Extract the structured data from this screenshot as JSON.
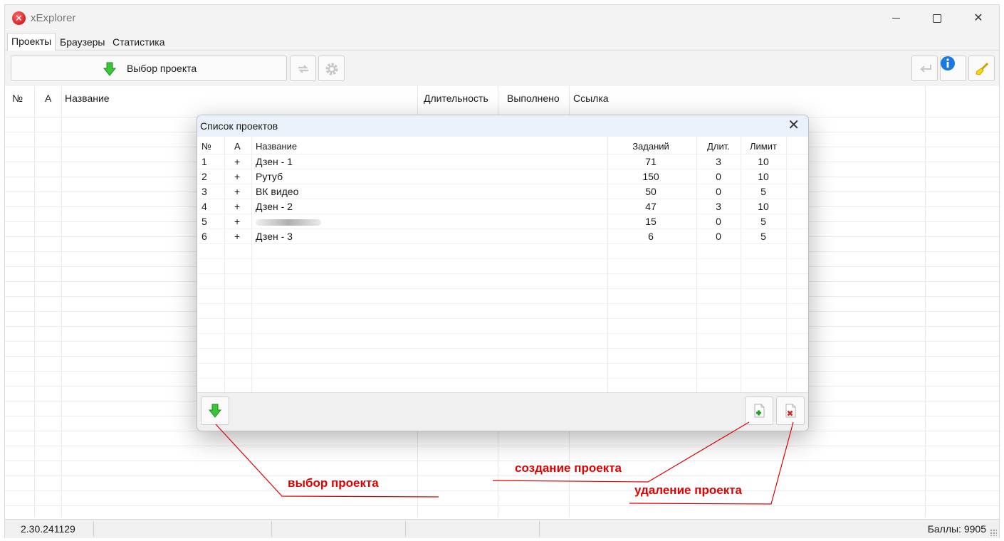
{
  "window": {
    "title": "xExplorer",
    "icon": "x-app-icon"
  },
  "tabs": [
    {
      "label": "Проекты",
      "active": true
    },
    {
      "label": "Браузеры",
      "active": false
    },
    {
      "label": "Статистика",
      "active": false
    }
  ],
  "toolbar": {
    "select_project_label": "Выбор проекта",
    "icons": [
      "green-down-arrow-icon",
      "swap-arrows-icon",
      "gear-icon",
      "return-arrow-icon",
      "info-icon",
      "brush-icon"
    ]
  },
  "main_table": {
    "columns": [
      "№",
      "A",
      "Название",
      "Длительность",
      "Выполнено",
      "Ссылка"
    ]
  },
  "dialog": {
    "title": "Список проектов",
    "columns": [
      "№",
      "A",
      "Название",
      "Заданий",
      "Длит.",
      "Лимит"
    ],
    "rows": [
      {
        "num": "1",
        "active": "+",
        "name": "Дзен - 1",
        "tasks": "71",
        "duration": "3",
        "limit": "10"
      },
      {
        "num": "2",
        "active": "+",
        "name": "Рутуб",
        "tasks": "150",
        "duration": "0",
        "limit": "10"
      },
      {
        "num": "3",
        "active": "+",
        "name": "ВК видео",
        "tasks": "50",
        "duration": "0",
        "limit": "5"
      },
      {
        "num": "4",
        "active": "+",
        "name": "Дзен - 2",
        "tasks": "47",
        "duration": "3",
        "limit": "10"
      },
      {
        "num": "5",
        "active": "+",
        "name": "",
        "tasks": "15",
        "duration": "0",
        "limit": "5"
      },
      {
        "num": "6",
        "active": "+",
        "name": "Дзен - 3",
        "tasks": "6",
        "duration": "0",
        "limit": "5"
      }
    ]
  },
  "annotations": {
    "select": "выбор проекта",
    "create": "создание проекта",
    "delete": "удаление проекта",
    "color": "#e00000"
  },
  "statusbar": {
    "version": "2.30.241129",
    "score": "Баллы: 9905"
  }
}
